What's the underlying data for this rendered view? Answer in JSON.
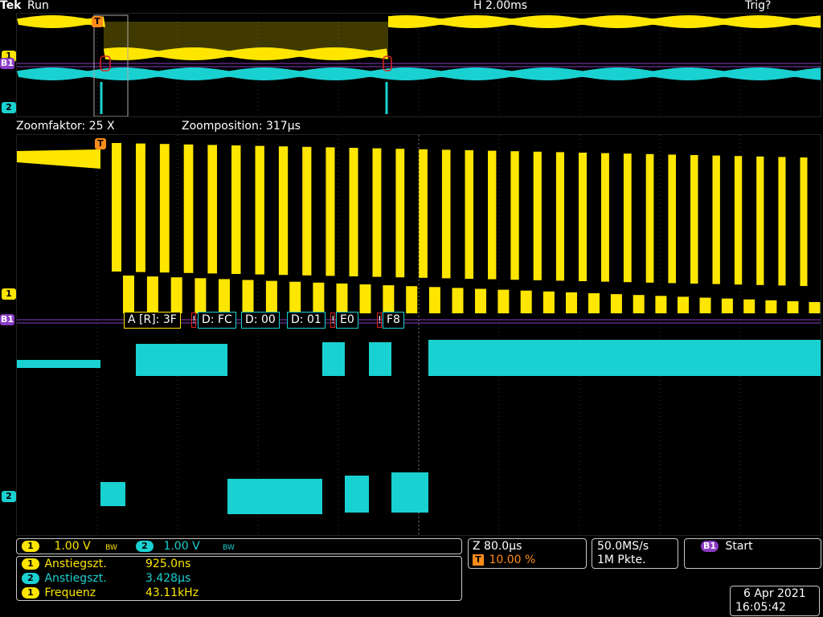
{
  "header": {
    "brand": "Tek",
    "run_state": "Run",
    "horizontal_scale": "H 2.00ms",
    "trigger_state": "Trig?"
  },
  "overview": {
    "markers": {
      "ch1": "1",
      "bus": "B1",
      "ch2": "2",
      "trigger": "T"
    }
  },
  "zoom_info": {
    "zoom_factor": "Zoomfaktor: 25 X",
    "zoom_position": "Zoomposition: 317µs"
  },
  "zoom": {
    "markers": {
      "ch1": "1",
      "bus": "B1",
      "ch2": "2",
      "trigger": "T"
    },
    "decode": [
      {
        "label": "A [R]: 3F",
        "kind": "address"
      },
      {
        "label": "D: FC",
        "kind": "data"
      },
      {
        "label": "D: 00",
        "kind": "data"
      },
      {
        "label": "D: 01",
        "kind": "data"
      },
      {
        "label": "E0",
        "kind": "data"
      },
      {
        "label": "F8",
        "kind": "data"
      }
    ],
    "error_glyph": "!"
  },
  "status": {
    "ch1_num": "1",
    "ch1_scale": "1.00 V",
    "ch1_bw": "BW",
    "ch2_num": "2",
    "ch2_scale": "1.00 V",
    "ch2_bw": "BW",
    "measurements": [
      {
        "ch": "1",
        "name": "Anstiegszt.",
        "value": "925.0ns"
      },
      {
        "ch": "2",
        "name": "Anstiegszt.",
        "value": "3.428µs"
      },
      {
        "ch": "1",
        "name": "Frequenz",
        "value": "43.11kHz"
      }
    ],
    "zoom_time": "Z 80.0µs",
    "trigger_pos": "10.00 %",
    "trigger_label": "T",
    "sample_rate": "50.0MS/s",
    "record_length": "1M Pkte.",
    "bus_label": "B1",
    "bus_trigger": "Start",
    "date": "6 Apr 2021",
    "time": "16:05:42"
  },
  "colors": {
    "ch1": "#ffe600",
    "ch2": "#1ad1d1",
    "bus": "#8a3cc4",
    "trigger": "#ff8c1a",
    "error": "#dd2222"
  }
}
